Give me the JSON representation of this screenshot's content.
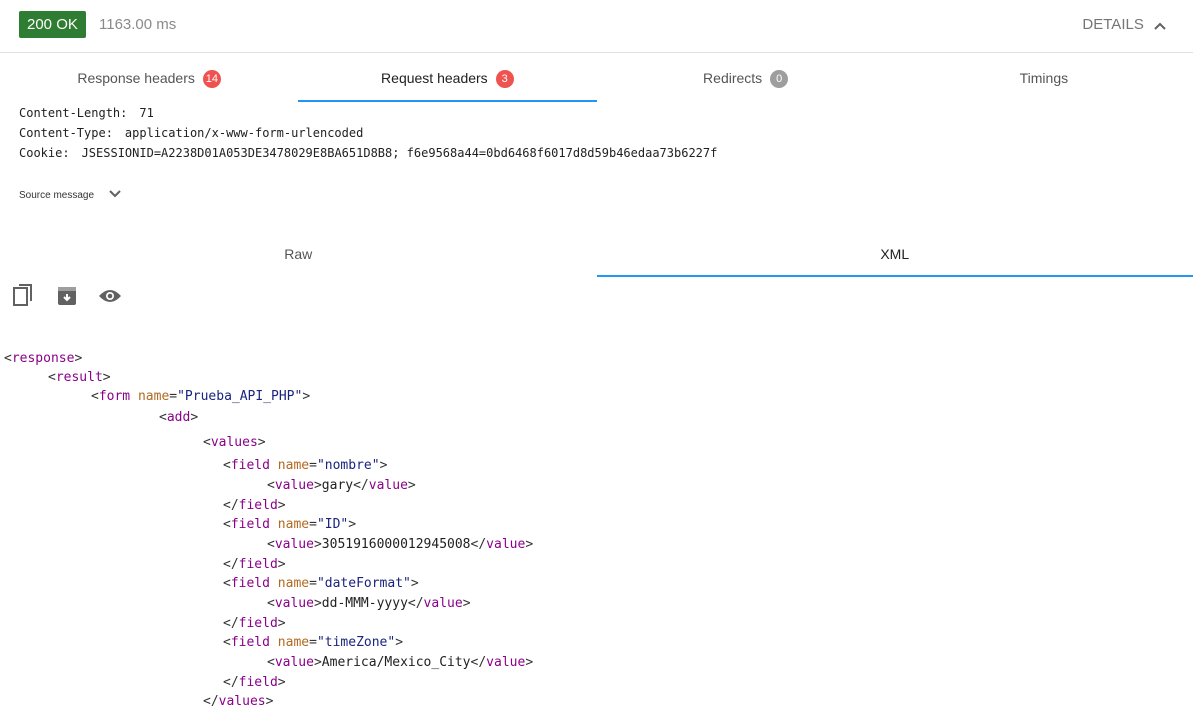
{
  "status": {
    "code_label": "200 OK",
    "time": "1163.00 ms",
    "details_label": "DETAILS"
  },
  "tabs": [
    {
      "label": "Response headers",
      "count": "14"
    },
    {
      "label": "Request headers",
      "count": "3"
    },
    {
      "label": "Redirects",
      "count": "0"
    },
    {
      "label": "Timings"
    }
  ],
  "request_headers": [
    {
      "name": "Content-Length:",
      "value": "71"
    },
    {
      "name": "Content-Type:",
      "value": "application/x-www-form-urlencoded"
    },
    {
      "name": "Cookie:",
      "value": "JSESSIONID=A2238D01A053DE3478029E8BA651D8B8; f6e9568a44=0bd6468f6017d8d59b46edaa73b6227f"
    }
  ],
  "source_message_label": "Source message",
  "view_tabs": {
    "raw": "Raw",
    "xml": "XML"
  },
  "icons": {
    "copy": "copy-icon",
    "save": "archive-icon",
    "preview": "eye-icon"
  },
  "colors": {
    "success": "#2e7d32",
    "badge": "#ef5350",
    "badge_zero": "#9e9e9e",
    "accent": "#2196f3"
  },
  "xml": {
    "response_tag": "response",
    "result_tag": "result",
    "form_tag": "form",
    "attr_name": "name",
    "form_name": "\"Prueba_API_PHP\"",
    "add_tag": "add",
    "values_tag": "values",
    "field_tag": "field",
    "value_tag": "value",
    "fields": [
      {
        "name": "\"nombre\"",
        "value": "gary"
      },
      {
        "name": "\"ID\"",
        "value": "3051916000012945008"
      },
      {
        "name": "\"dateFormat\"",
        "value": "dd-MMM-yyyy"
      },
      {
        "name": "\"timeZone\"",
        "value": "America/Mexico_City"
      }
    ]
  }
}
